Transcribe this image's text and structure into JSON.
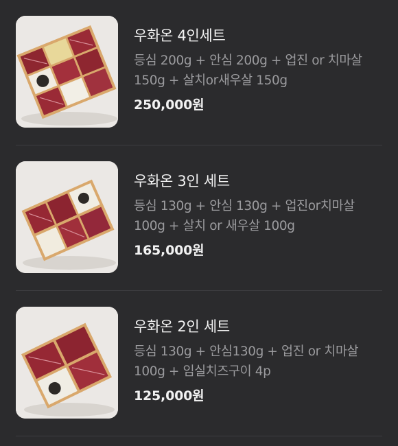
{
  "menu": {
    "items": [
      {
        "title": "우화온 4인세트",
        "description": "등심 200g + 안심 200g + 업진 or 치마살 150g + 살치or새우살 150g",
        "price": "250,000원",
        "image_alt": "4-person wagyu set box"
      },
      {
        "title": "우화온 3인 세트",
        "description": "등심 130g + 안심 130g + 업진or치마살 100g + 살치 or 새우살 100g",
        "price": "165,000원",
        "image_alt": "3-person wagyu set box"
      },
      {
        "title": "우화온 2인 세트",
        "description": "등심 130g + 안심130g + 업진 or 치마살 100g + 임실치즈구이 4p",
        "price": "125,000원",
        "image_alt": "2-person wagyu set box"
      }
    ]
  },
  "colors": {
    "background": "#2b2b2d",
    "title": "#f2f2f2",
    "description": "#9b9b9e",
    "divider": "#3d3d40"
  }
}
